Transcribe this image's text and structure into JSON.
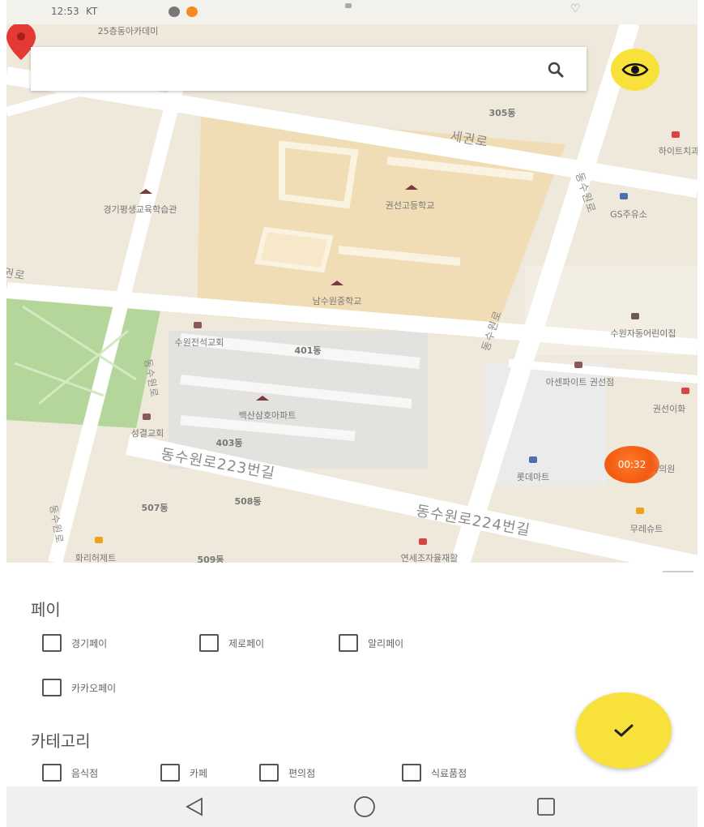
{
  "status_bar": {
    "time": "12:53",
    "carrier": "KT"
  },
  "search": {
    "value": "",
    "placeholder": ""
  },
  "map": {
    "top_partial_label": "25층동아카데미",
    "buildings": [
      "305동",
      "401동",
      "403동",
      "508동",
      "507동",
      "509동"
    ],
    "pois": [
      "경기평생교육학습관",
      "권선고등학교",
      "GS주유소",
      "남수원중학교",
      "수원전석교회",
      "백산삼호아파트",
      "성결교회",
      "아센파이트 권선점",
      "수원자동어린이집",
      "권선이화",
      "롯데마트",
      "올바른치과의원",
      "무레슈트",
      "하이트치과",
      "화리허제트",
      "연세조자율재활"
    ],
    "roads": [
      "세권로",
      "동수원로",
      "동수원로223번길",
      "동수원로224번길",
      "권로"
    ],
    "timer": "00:32"
  },
  "filters": {
    "pay_title": "페이",
    "pay_options": [
      "경기페이",
      "제로페이",
      "알리페이",
      "카카오페이"
    ],
    "category_title": "카테고리",
    "category_options": [
      "음식점",
      "카페",
      "편의점",
      "식료품점"
    ]
  },
  "colors": {
    "accent_yellow": "#f7e13a",
    "pin_red": "#e53935",
    "park_green": "#a8cf8a",
    "school_beige": "#f0dcb4"
  },
  "icons": {
    "search": "search-icon",
    "location": "eye-target-icon",
    "confirm": "checkmark-icon",
    "nav_back": "triangle-back-icon",
    "nav_home": "circle-home-icon",
    "nav_recent": "square-recent-icon"
  }
}
